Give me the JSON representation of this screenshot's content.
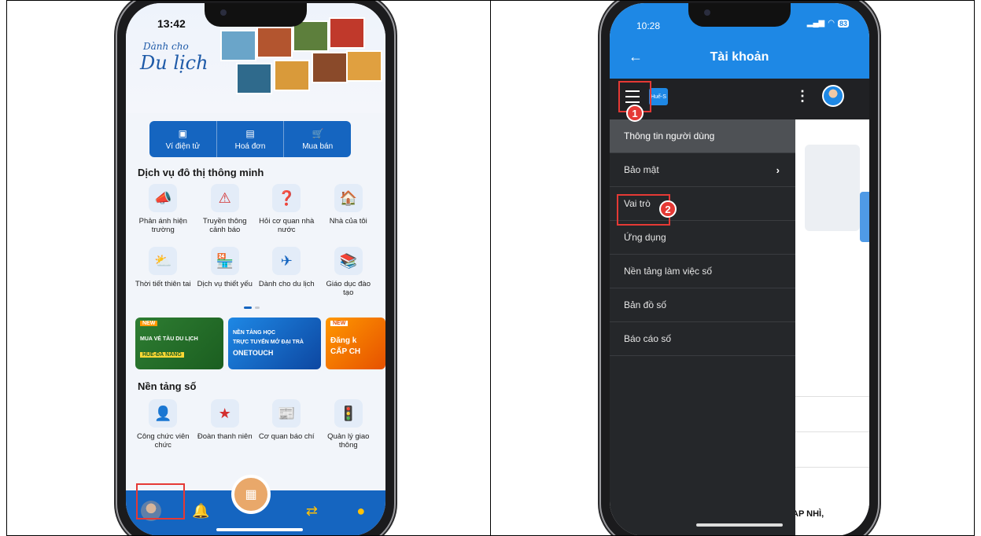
{
  "left_phone": {
    "status_time": "13:42",
    "banner": {
      "line1": "Dành cho",
      "line2": "Du lịch"
    },
    "quick_bar": [
      {
        "label": "Ví điện tử",
        "icon": "wallet-icon"
      },
      {
        "label": "Hoá đơn",
        "icon": "invoice-icon"
      },
      {
        "label": "Mua bán",
        "icon": "cart-icon"
      }
    ],
    "smart_services_title": "Dịch vụ đô thị thông minh",
    "smart_services": [
      {
        "label": "Phản ánh hiện trường",
        "icon": "report-icon",
        "glyph": "📣"
      },
      {
        "label": "Truyền thông cảnh báo",
        "icon": "warning-icon",
        "glyph": "⚠"
      },
      {
        "label": "Hỏi cơ quan nhà nước",
        "icon": "question-icon",
        "glyph": "❓"
      },
      {
        "label": "Nhà của tôi",
        "icon": "house-icon",
        "glyph": "🏠"
      },
      {
        "label": "Thời tiết thiên tai",
        "icon": "weather-icon",
        "glyph": "⛅"
      },
      {
        "label": "Dịch vụ thiết yếu",
        "icon": "essential-service-icon",
        "glyph": "🏪"
      },
      {
        "label": "Dành cho du lịch",
        "icon": "plane-icon",
        "glyph": "✈"
      },
      {
        "label": "Giáo dục đào tạo",
        "icon": "education-icon",
        "glyph": "📚"
      }
    ],
    "promos": [
      {
        "badge": "NEW",
        "text1": "MUA VÉ TÀU DU LỊCH",
        "text2": "HUẾ-ĐÀ NẴNG"
      },
      {
        "text1": "NỀN TẢNG HỌC",
        "text2": "TRỰC TUYẾN MỞ ĐẠI TRÀ",
        "text3": "ONETOUCH"
      },
      {
        "badge": "NEW",
        "text1": "Đăng k",
        "text2": "CẤP CH"
      }
    ],
    "digital_platform_title": "Nền tảng số",
    "digital_platforms": [
      {
        "label": "Công chức viên chức",
        "icon": "civil-servant-icon",
        "glyph": "👤"
      },
      {
        "label": "Đoàn thanh niên",
        "icon": "youth-union-icon",
        "glyph": "★"
      },
      {
        "label": "Cơ quan báo chí",
        "icon": "press-icon",
        "glyph": "📰"
      },
      {
        "label": "Quản lý giao thông",
        "icon": "traffic-icon",
        "glyph": "🚦"
      }
    ],
    "bottom_nav": [
      "profile-avatar",
      "bell-icon",
      "qr-scan-icon",
      "transfer-icon",
      "location-pin-icon"
    ]
  },
  "right_phone": {
    "status_time": "10:28",
    "battery": "83",
    "title": "Tài khoản",
    "logo_text": "Huế-S",
    "menu": [
      {
        "label": "Thông tin người dùng",
        "active": true
      },
      {
        "label": "Bảo mật",
        "chevron": "›"
      },
      {
        "label": "Vai trò"
      },
      {
        "label": "Ứng dụng"
      },
      {
        "label": "Nền tảng làm việc số"
      },
      {
        "label": "Bản đồ số"
      },
      {
        "label": "Báo cáo số"
      }
    ],
    "step1": "1",
    "step2": "2",
    "bottom_text": "AP NHÌ,"
  },
  "colors": {
    "primary_blue": "#1e88e5",
    "annotation_red": "#e53935",
    "drawer_bg": "#25272a"
  }
}
